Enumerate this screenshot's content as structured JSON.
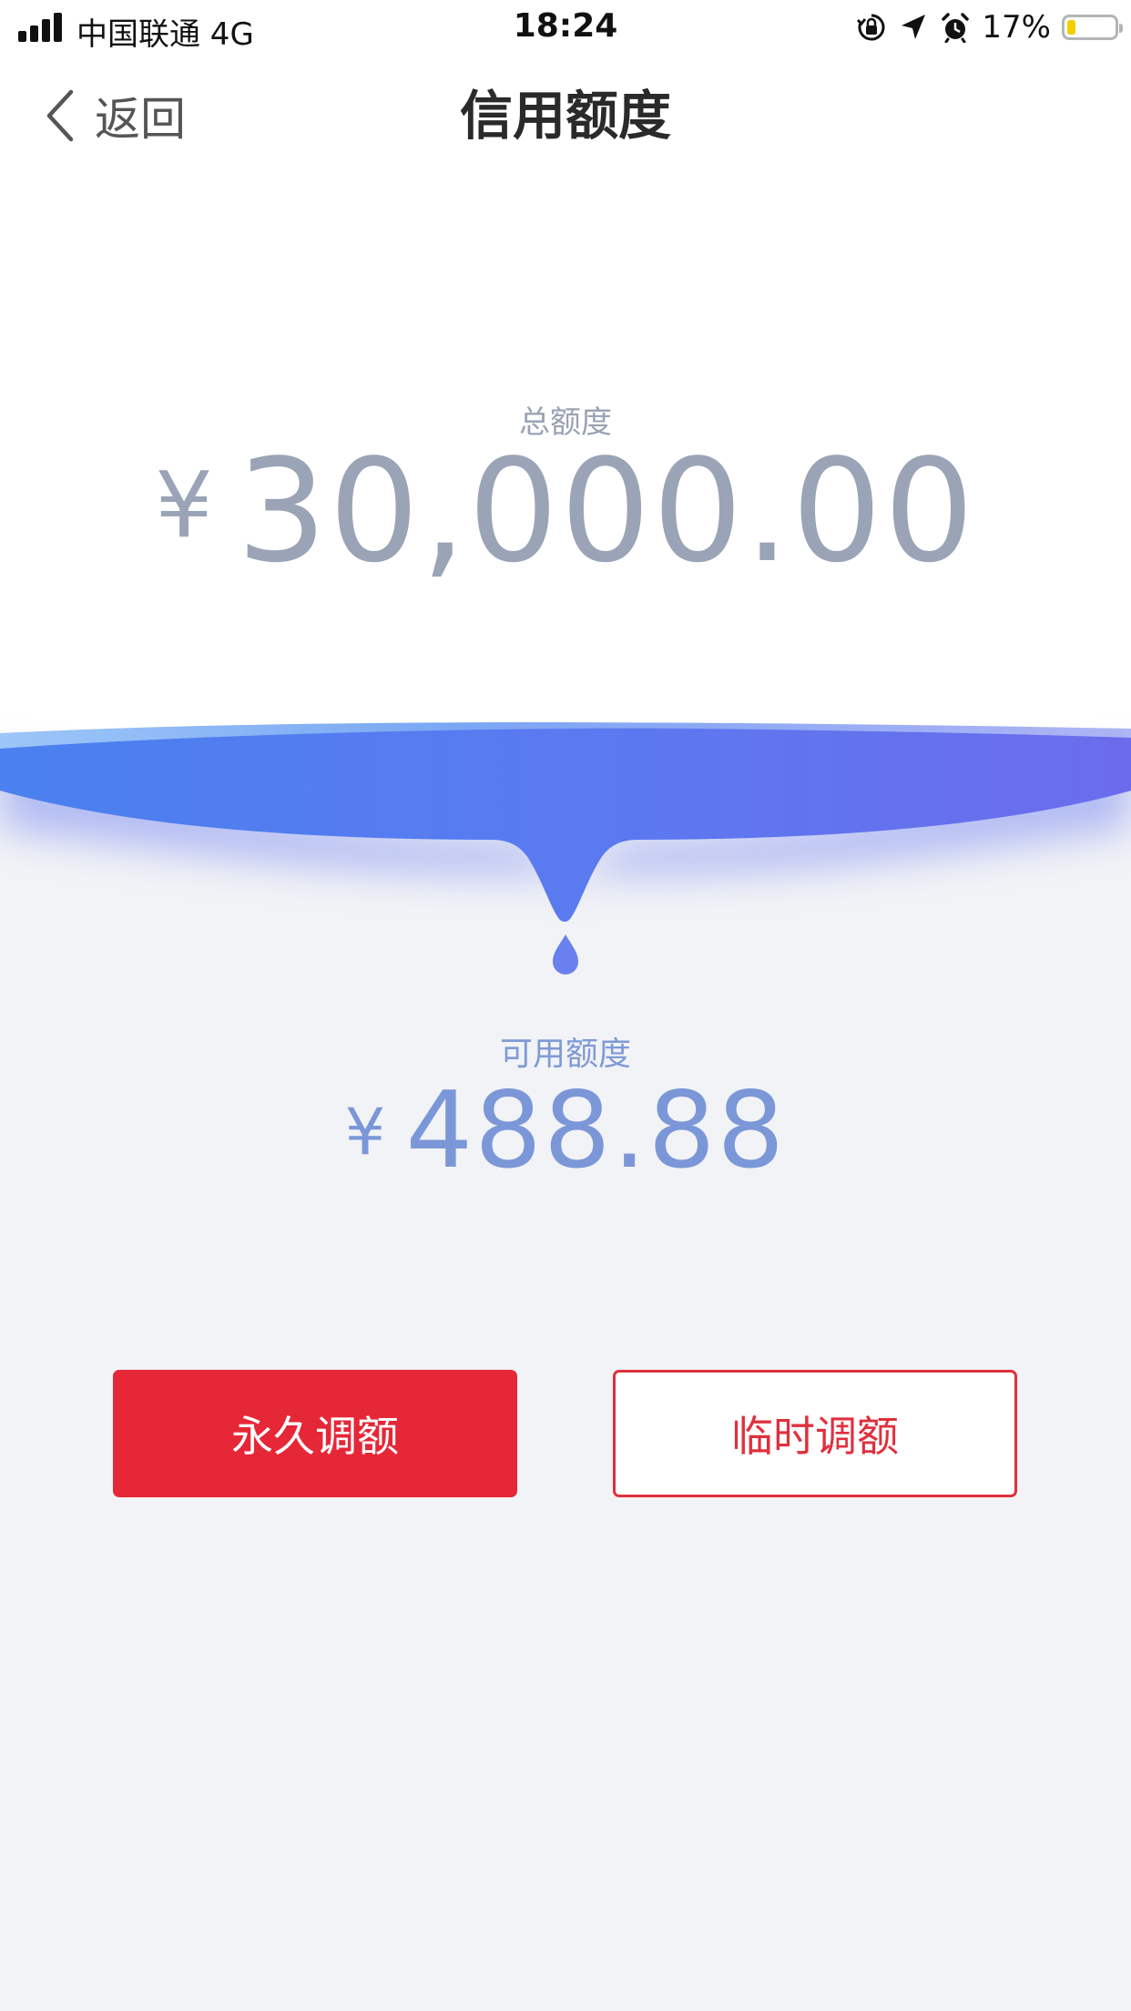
{
  "status_bar": {
    "carrier": "中国联通   4G",
    "time": "18:24",
    "battery_percent": "17%",
    "battery_level": 0.17,
    "icons": [
      "signal-bars-icon",
      "orientation-lock-icon",
      "location-arrow-icon",
      "alarm-clock-icon",
      "battery-icon"
    ]
  },
  "nav": {
    "back_label": "返回",
    "title": "信用额度"
  },
  "credit": {
    "total_label": "总额度",
    "currency_symbol": "¥",
    "total_value": "30,000.00",
    "available_label": "可用额度",
    "available_value": "488.88"
  },
  "actions": {
    "permanent_label": "永久调额",
    "temporary_label": "临时调额"
  },
  "colors": {
    "accent_red": "#e62737",
    "wave_blue_start": "#4a80ef",
    "wave_blue_end": "#6b6cec",
    "total_text": "#9aa4b6",
    "available_text": "#7b97d8",
    "page_background": "#f2f3f6"
  }
}
